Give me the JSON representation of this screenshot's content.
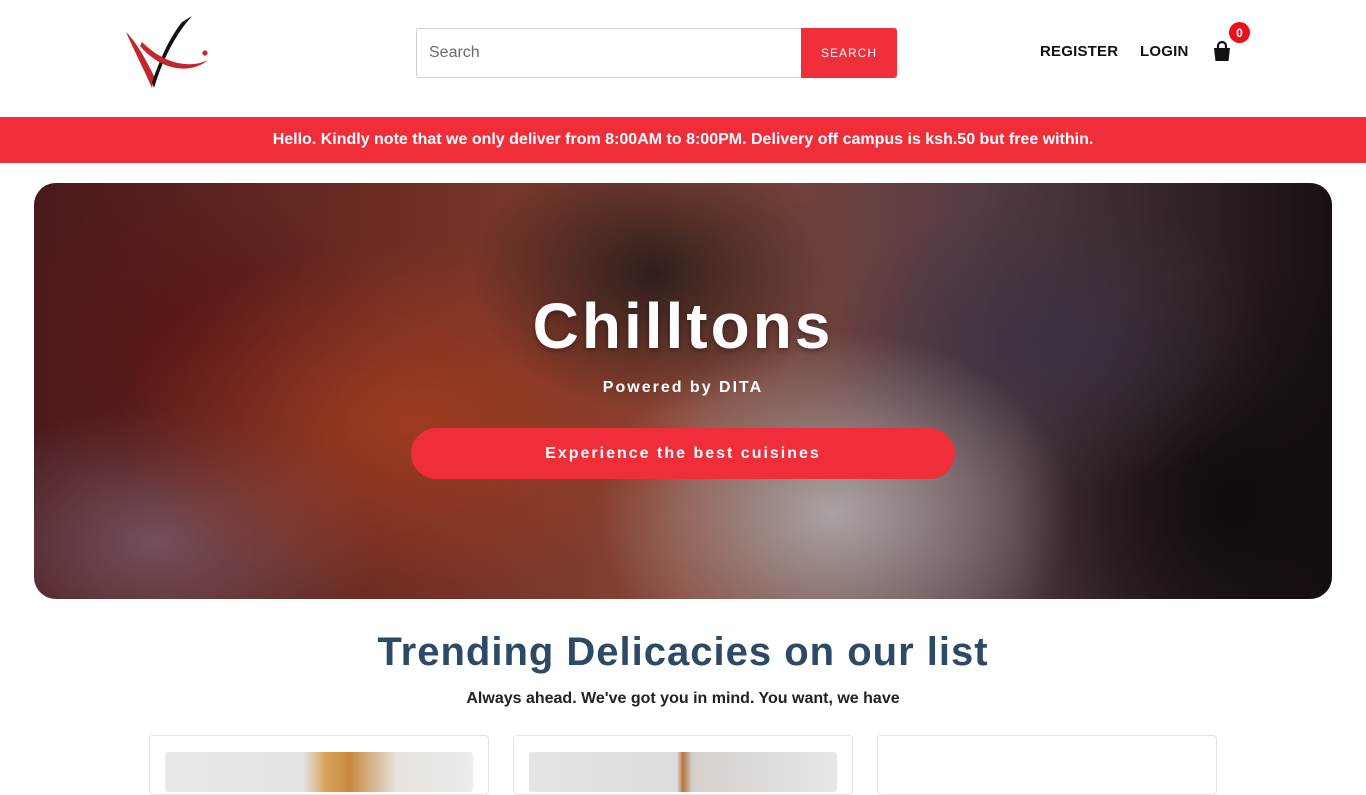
{
  "header": {
    "logo_name": "brand-logo",
    "search": {
      "placeholder": "Search",
      "value": "",
      "button_label": "SEARCH"
    },
    "nav": {
      "register_label": "REGISTER",
      "login_label": "LOGIN"
    },
    "cart": {
      "count": "0",
      "icon": "shopping-bag-icon"
    }
  },
  "notice": {
    "text": "Hello. Kindly note that we only deliver from 8:00AM to 8:00PM. Delivery off campus is ksh.50 but free within."
  },
  "hero": {
    "title": "Chilltons",
    "subtitle": "Powered by DITA",
    "cta_label": "Experience the best cuisines"
  },
  "trending": {
    "title": "Trending Delicacies on our list",
    "subtitle": "Always ahead. We've got you in mind. You want, we have"
  },
  "colors": {
    "accent": "#ef2e3a",
    "heading": "#2c4a66",
    "badge": "#e8121d"
  }
}
